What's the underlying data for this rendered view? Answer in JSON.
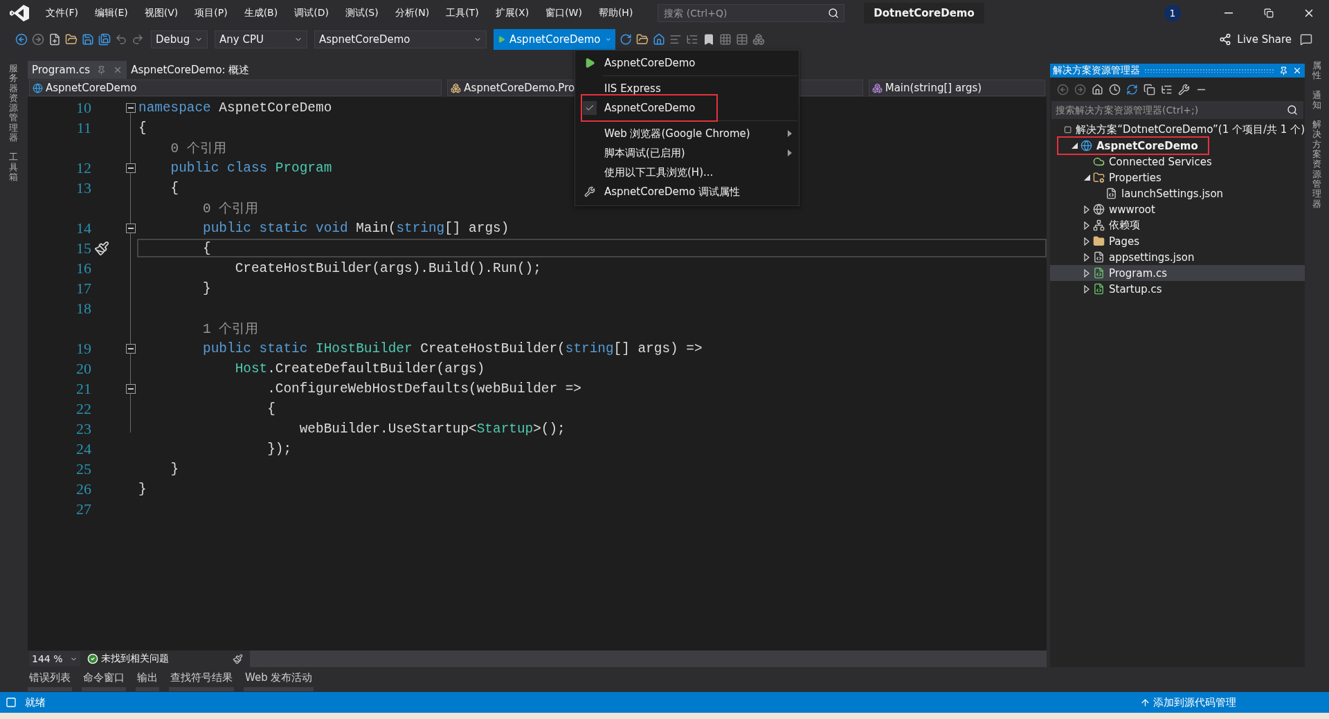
{
  "menu_bar": {
    "items": [
      "文件(F)",
      "编辑(E)",
      "视图(V)",
      "项目(P)",
      "生成(B)",
      "调试(D)",
      "测试(S)",
      "分析(N)",
      "工具(T)",
      "扩展(X)",
      "窗口(W)",
      "帮助(H)"
    ],
    "search": {
      "placeholder": "搜索 (Ctrl+Q)"
    },
    "solution_name": "DotnetCoreDemo",
    "notifications": "1"
  },
  "toolbar": {
    "configuration": "Debug",
    "platform": "Any CPU",
    "startup_project": "AspnetCoreDemo",
    "run_target": "AspnetCoreDemo",
    "live_share": "Live Share"
  },
  "left_rail": [
    "服务器资源管理器",
    "工具箱"
  ],
  "doc_tabs": [
    {
      "label": "Program.cs",
      "selected": true
    },
    {
      "label": "AspnetCoreDemo: 概述",
      "selected": false
    }
  ],
  "nav_bar": [
    "AspnetCoreDemo",
    "AspnetCoreDemo.Pro",
    "Main(string[] args)"
  ],
  "code": {
    "lines": [
      {
        "kind": "code",
        "number": "10",
        "fold": true,
        "current": false,
        "tokens": [
          {
            "text": "namespace",
            "kind": "keyword"
          },
          {
            "text": " AspnetCoreDemo",
            "kind": "plain"
          }
        ]
      },
      {
        "kind": "code",
        "number": "11",
        "fold": false,
        "current": false,
        "tokens": [
          {
            "text": "{",
            "kind": "plain"
          }
        ]
      },
      {
        "kind": "lens",
        "text": "    0 个引用"
      },
      {
        "kind": "code",
        "number": "12",
        "fold": true,
        "current": false,
        "tokens": [
          {
            "text": "    public class",
            "kind": "keyword"
          },
          {
            "text": " Program",
            "kind": "type"
          }
        ]
      },
      {
        "kind": "code",
        "number": "13",
        "fold": false,
        "current": false,
        "tokens": [
          {
            "text": "    {",
            "kind": "plain"
          }
        ]
      },
      {
        "kind": "lens",
        "text": "        0 个引用"
      },
      {
        "kind": "code",
        "number": "14",
        "fold": true,
        "current": false,
        "tokens": [
          {
            "text": "        public static void",
            "kind": "keyword"
          },
          {
            "text": " Main(",
            "kind": "plain"
          },
          {
            "text": "string",
            "kind": "keyword"
          },
          {
            "text": "[] args)",
            "kind": "plain"
          }
        ]
      },
      {
        "kind": "code",
        "number": "15",
        "fold": false,
        "current": true,
        "tokens": [
          {
            "text": "        {",
            "kind": "plain"
          }
        ]
      },
      {
        "kind": "code",
        "number": "16",
        "fold": false,
        "current": false,
        "tokens": [
          {
            "text": "            CreateHostBuilder(args).Build().Run();",
            "kind": "plain"
          }
        ]
      },
      {
        "kind": "code",
        "number": "17",
        "fold": false,
        "current": false,
        "tokens": [
          {
            "text": "        }",
            "kind": "plain"
          }
        ]
      },
      {
        "kind": "code",
        "number": "18",
        "fold": false,
        "current": false
      },
      {
        "kind": "lens",
        "text": "        1 个引用"
      },
      {
        "kind": "code",
        "number": "19",
        "fold": true,
        "current": false,
        "tokens": [
          {
            "text": "        public static",
            "kind": "keyword"
          },
          {
            "text": " IHostBuilder",
            "kind": "type"
          },
          {
            "text": " CreateHostBuilder(",
            "kind": "plain"
          },
          {
            "text": "string",
            "kind": "keyword"
          },
          {
            "text": "[] args) =>",
            "kind": "plain"
          }
        ]
      },
      {
        "kind": "code",
        "number": "20",
        "fold": false,
        "current": false,
        "tokens": [
          {
            "text": "            Host",
            "kind": "type"
          },
          {
            "text": ".CreateDefaultBuilder(args)",
            "kind": "plain"
          }
        ]
      },
      {
        "kind": "code",
        "number": "21",
        "fold": true,
        "current": false,
        "tokens": [
          {
            "text": "                .ConfigureWebHostDefaults(webBuilder =>",
            "kind": "plain"
          }
        ]
      },
      {
        "kind": "code",
        "number": "22",
        "fold": false,
        "current": false,
        "tokens": [
          {
            "text": "                {",
            "kind": "plain"
          }
        ]
      },
      {
        "kind": "code",
        "number": "23",
        "fold": false,
        "current": false,
        "tokens": [
          {
            "text": "                    webBuilder.UseStartup<",
            "kind": "plain"
          },
          {
            "text": "Startup",
            "kind": "type"
          },
          {
            "text": ">();",
            "kind": "plain"
          }
        ]
      },
      {
        "kind": "code",
        "number": "24",
        "fold": false,
        "current": false,
        "tokens": [
          {
            "text": "                });",
            "kind": "plain"
          }
        ]
      },
      {
        "kind": "code",
        "number": "25",
        "fold": false,
        "current": false,
        "tokens": [
          {
            "text": "    }",
            "kind": "plain"
          }
        ]
      },
      {
        "kind": "code",
        "number": "26",
        "fold": false,
        "current": false,
        "tokens": [
          {
            "text": "}",
            "kind": "plain"
          }
        ]
      },
      {
        "kind": "code",
        "number": "27",
        "fold": false,
        "current": false
      }
    ]
  },
  "launch_menu": {
    "items": [
      {
        "label": "AspnetCoreDemo",
        "kind": "launch",
        "checked": false,
        "outlined": false
      },
      {
        "label": "IIS Express",
        "kind": "profile",
        "checked": false,
        "outlined": false
      },
      {
        "label": "AspnetCoreDemo",
        "kind": "profile",
        "checked": true,
        "outlined": true
      },
      {
        "label": "Web 浏览器(Google Chrome)",
        "kind": "submenu",
        "checked": false,
        "outlined": false
      },
      {
        "label": "脚本调试(已启用)",
        "kind": "submenu",
        "checked": false,
        "outlined": false
      },
      {
        "label": "使用以下工具浏览(H)...",
        "kind": "plain",
        "checked": false,
        "outlined": false
      },
      {
        "label": "AspnetCoreDemo 调试属性",
        "kind": "settings",
        "checked": false,
        "outlined": false
      }
    ]
  },
  "solution_explorer": {
    "title": "解决方案资源管理器",
    "search": {
      "placeholder": "搜索解决方案资源管理器(Ctrl+;)"
    },
    "tree": [
      {
        "label": "解决方案“DotnetCoreDemo”(1 个项目/共 1 个)",
        "kind": "solution",
        "selected": false,
        "outlined": false,
        "children": [
          {
            "label": "AspnetCoreDemo",
            "kind": "web-project",
            "expanded": true,
            "selected": false,
            "outlined": true,
            "children": [
              {
                "label": "Connected Services",
                "kind": "services",
                "selected": false,
                "outlined": false
              },
              {
                "label": "Properties",
                "kind": "properties",
                "expanded": true,
                "selected": false,
                "outlined": false,
                "children": [
                  {
                    "label": "launchSettings.json",
                    "kind": "json",
                    "selected": false,
                    "outlined": false
                  }
                ]
              },
              {
                "label": "wwwroot",
                "kind": "web",
                "expanded": false,
                "selected": false,
                "outlined": false
              },
              {
                "label": "依赖项",
                "kind": "dependencies",
                "expanded": false,
                "selected": false,
                "outlined": false
              },
              {
                "label": "Pages",
                "kind": "folder",
                "expanded": false,
                "selected": false,
                "outlined": false
              },
              {
                "label": "appsettings.json",
                "kind": "json",
                "expanded": false,
                "selected": false,
                "outlined": false
              },
              {
                "label": "Program.cs",
                "kind": "csharp",
                "expanded": false,
                "selected": true,
                "outlined": false
              },
              {
                "label": "Startup.cs",
                "kind": "csharp",
                "expanded": false,
                "selected": false,
                "outlined": false
              }
            ]
          }
        ]
      }
    ]
  },
  "right_rail": [
    "属性",
    "通知",
    "解决方案资源管理器"
  ],
  "editor_status": {
    "zoom": "144 %",
    "issues": "未找到相关问题"
  },
  "tool_tabs": [
    "错误列表",
    "命令窗口",
    "输出",
    "查找符号结果",
    "Web 发布活动"
  ],
  "status_bar": {
    "text": "就绪",
    "source_control": "添加到源代码管理"
  }
}
